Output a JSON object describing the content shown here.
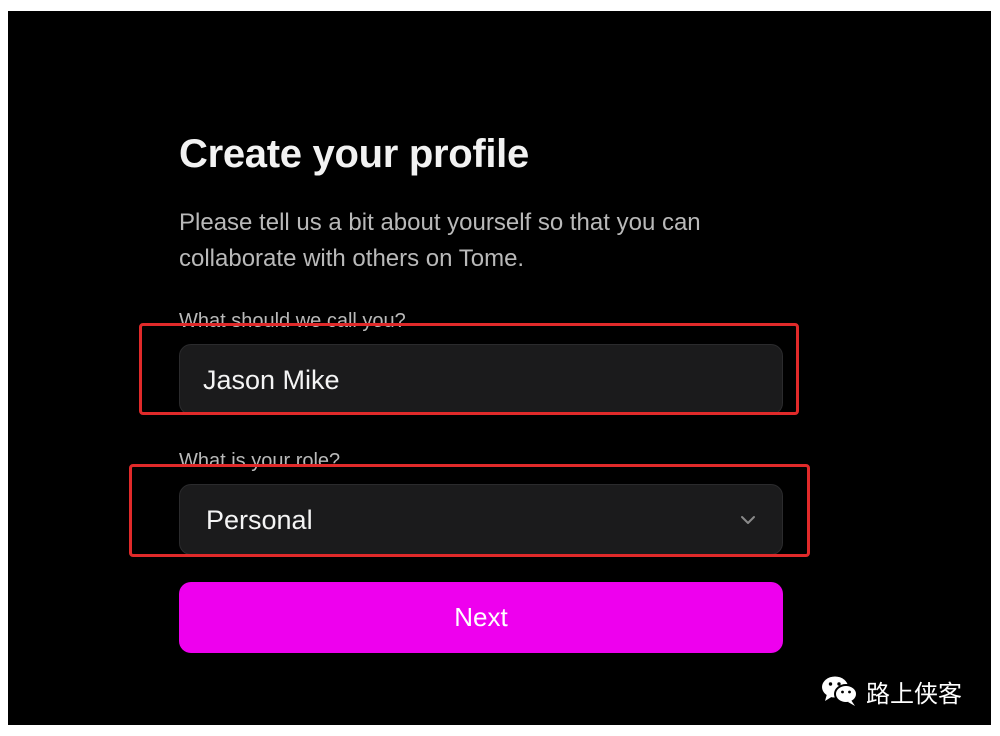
{
  "profile": {
    "title": "Create your profile",
    "subtitle": "Please tell us a bit about yourself so that you can collaborate with others on Tome.",
    "name_field": {
      "label": "What should we call you?",
      "value": "Jason Mike"
    },
    "role_field": {
      "label": "What is your role?",
      "value": "Personal",
      "icon": "chevron-down-icon"
    },
    "next_label": "Next"
  },
  "watermark": {
    "icon": "wechat-icon",
    "text": "路上侠客"
  },
  "colors": {
    "background": "#000000",
    "accent": "#ee00ee",
    "input_bg": "#1b1b1c",
    "highlight": "#e02a2a"
  }
}
